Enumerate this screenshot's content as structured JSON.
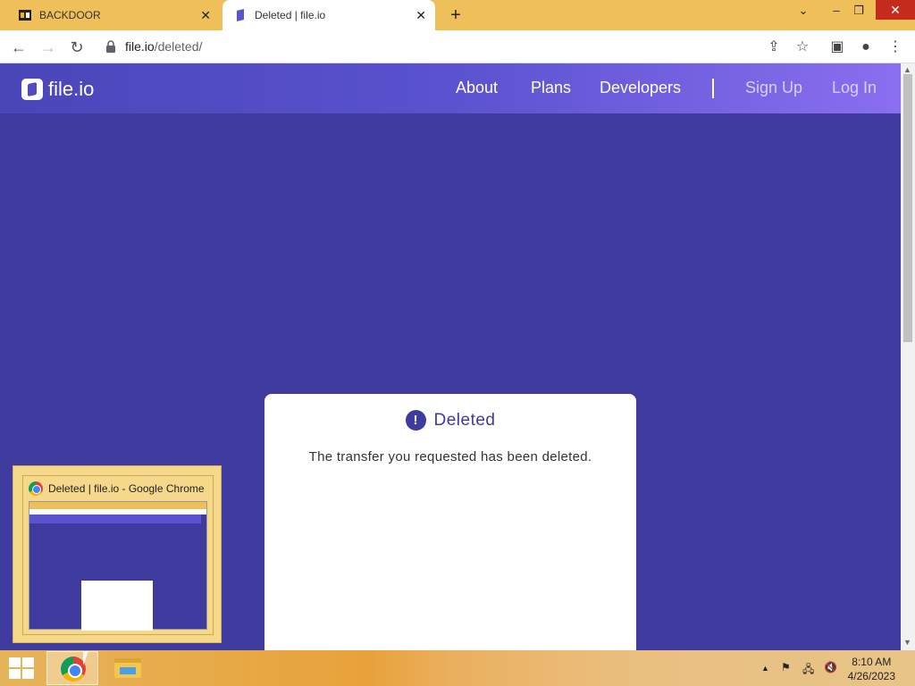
{
  "browser": {
    "tabs": [
      {
        "title": "BACKDOOR",
        "active": false
      },
      {
        "title": "Deleted | file.io",
        "active": true
      }
    ],
    "new_tab": "+",
    "url_host": "file.io",
    "url_path": "/deleted/"
  },
  "site": {
    "logo": "file.io",
    "nav": [
      {
        "label": "About"
      },
      {
        "label": "Plans"
      },
      {
        "label": "Developers"
      }
    ],
    "auth": [
      {
        "label": "Sign Up"
      },
      {
        "label": "Log In"
      }
    ],
    "card": {
      "icon": "!",
      "title": "Deleted",
      "message": "The transfer you requested has been deleted."
    }
  },
  "taskbar": {
    "thumbnail_title": "Deleted | file.io - Google Chrome",
    "time": "8:10 AM",
    "date": "4/26/2023"
  },
  "colors": {
    "page_bg": "#3f3a9e",
    "tabbar": "#efc05a",
    "accent": "#3f3a9e"
  }
}
